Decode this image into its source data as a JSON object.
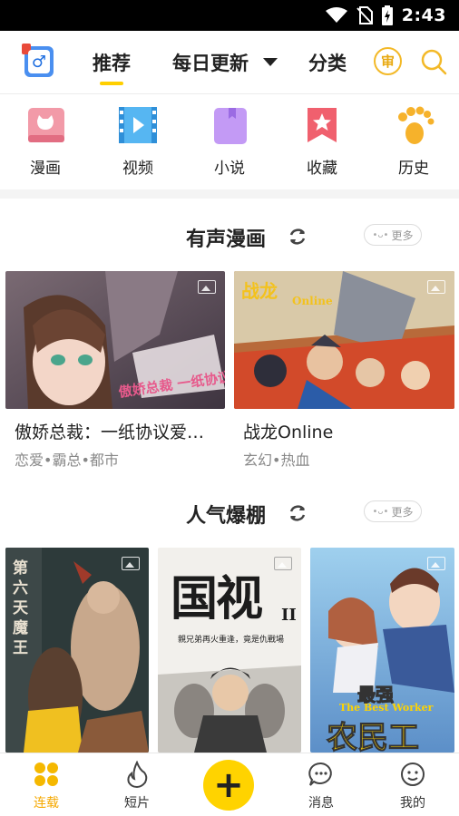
{
  "status_bar": {
    "time": "2:43"
  },
  "top_nav": {
    "tabs": [
      {
        "label": "推荐",
        "active": true
      },
      {
        "label": "每日更新",
        "active": false
      },
      {
        "label": "分类",
        "active": false
      }
    ],
    "shen_label": "审"
  },
  "quick_entries": [
    {
      "label": "漫画",
      "icon": "comic-book-icon"
    },
    {
      "label": "视频",
      "icon": "video-icon"
    },
    {
      "label": "小说",
      "icon": "novel-book-icon"
    },
    {
      "label": "收藏",
      "icon": "favorite-star-icon"
    },
    {
      "label": "历史",
      "icon": "footprint-history-icon"
    }
  ],
  "sections": [
    {
      "title": "有声漫画",
      "more_label": "更多",
      "cards": [
        {
          "title": "傲娇总裁：一纸协议爱…",
          "tags": "恋爱•霸总•都市",
          "cover_text": "傲娇总裁 一纸协议爱上"
        },
        {
          "title": "战龙Online",
          "tags": "玄幻•热血",
          "cover_text": "战龙",
          "cover_subtext": "Online"
        }
      ]
    },
    {
      "title": "人气爆棚",
      "more_label": "更多",
      "cards": [
        {
          "cover_text": "第六天魔王"
        },
        {
          "cover_text": "国视",
          "cover_numeral": "II",
          "cover_caption": "親兄弟再火重逢，竟是仇戰場"
        },
        {
          "cover_text": "最强",
          "cover_subtext": "The Best Worker",
          "cover_main": "农民工"
        }
      ]
    }
  ],
  "bottom_nav": {
    "items": [
      {
        "label": "连载",
        "active": true
      },
      {
        "label": "短片",
        "active": false
      },
      {
        "label": "",
        "active": false
      },
      {
        "label": "消息",
        "active": false
      },
      {
        "label": "我的",
        "active": false
      }
    ],
    "plus_label": "+"
  },
  "colors": {
    "accent": "#ffd300",
    "active_text": "#f5a800",
    "tag_gray": "#888888"
  }
}
